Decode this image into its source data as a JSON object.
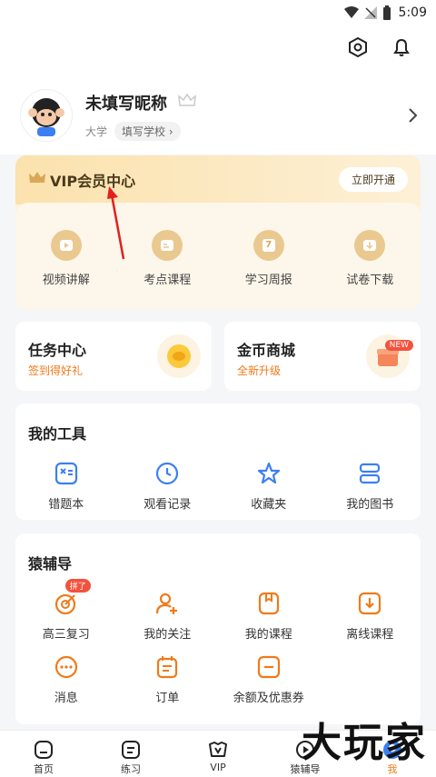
{
  "status_bar": {
    "time": "5:09"
  },
  "profile": {
    "nickname": "未填写昵称",
    "education": "大学",
    "school_button": "填写学校"
  },
  "vip": {
    "title": "VIP会员中心",
    "open_button": "立即开通",
    "items": [
      {
        "label": "视频讲解",
        "icon": "play-icon"
      },
      {
        "label": "考点课程",
        "icon": "course-icon"
      },
      {
        "label": "学习周报",
        "icon": "calendar-icon",
        "icon_text": "7"
      },
      {
        "label": "试卷下载",
        "icon": "download-icon"
      }
    ]
  },
  "task_center": {
    "title": "任务中心",
    "subtitle": "签到得好礼"
  },
  "coin_mall": {
    "title": "金币商城",
    "subtitle": "全新升级",
    "badge": "NEW"
  },
  "tools": {
    "title": "我的工具",
    "items": [
      {
        "label": "错题本",
        "icon": "wrong-book-icon"
      },
      {
        "label": "观看记录",
        "icon": "clock-icon"
      },
      {
        "label": "收藏夹",
        "icon": "star-icon"
      },
      {
        "label": "我的图书",
        "icon": "books-icon"
      }
    ]
  },
  "ape": {
    "title": "猿辅导",
    "items": [
      {
        "label": "高三复习",
        "icon": "target-icon",
        "tag": "拼了"
      },
      {
        "label": "我的关注",
        "icon": "user-add-icon"
      },
      {
        "label": "我的课程",
        "icon": "my-course-icon"
      },
      {
        "label": "离线课程",
        "icon": "offline-download-icon"
      },
      {
        "label": "消息",
        "icon": "message-icon"
      },
      {
        "label": "订单",
        "icon": "order-icon"
      },
      {
        "label": "余额及优惠券",
        "icon": "wallet-icon"
      }
    ]
  },
  "tabbar": [
    {
      "label": "首页"
    },
    {
      "label": "练习"
    },
    {
      "label": "VIP"
    },
    {
      "label": "猿辅导"
    },
    {
      "label": "我"
    }
  ],
  "watermark": "大玩家",
  "colors": {
    "accent": "#f07a1a",
    "vip_gold": "#e9c98f",
    "blue": "#3b7ff2"
  }
}
